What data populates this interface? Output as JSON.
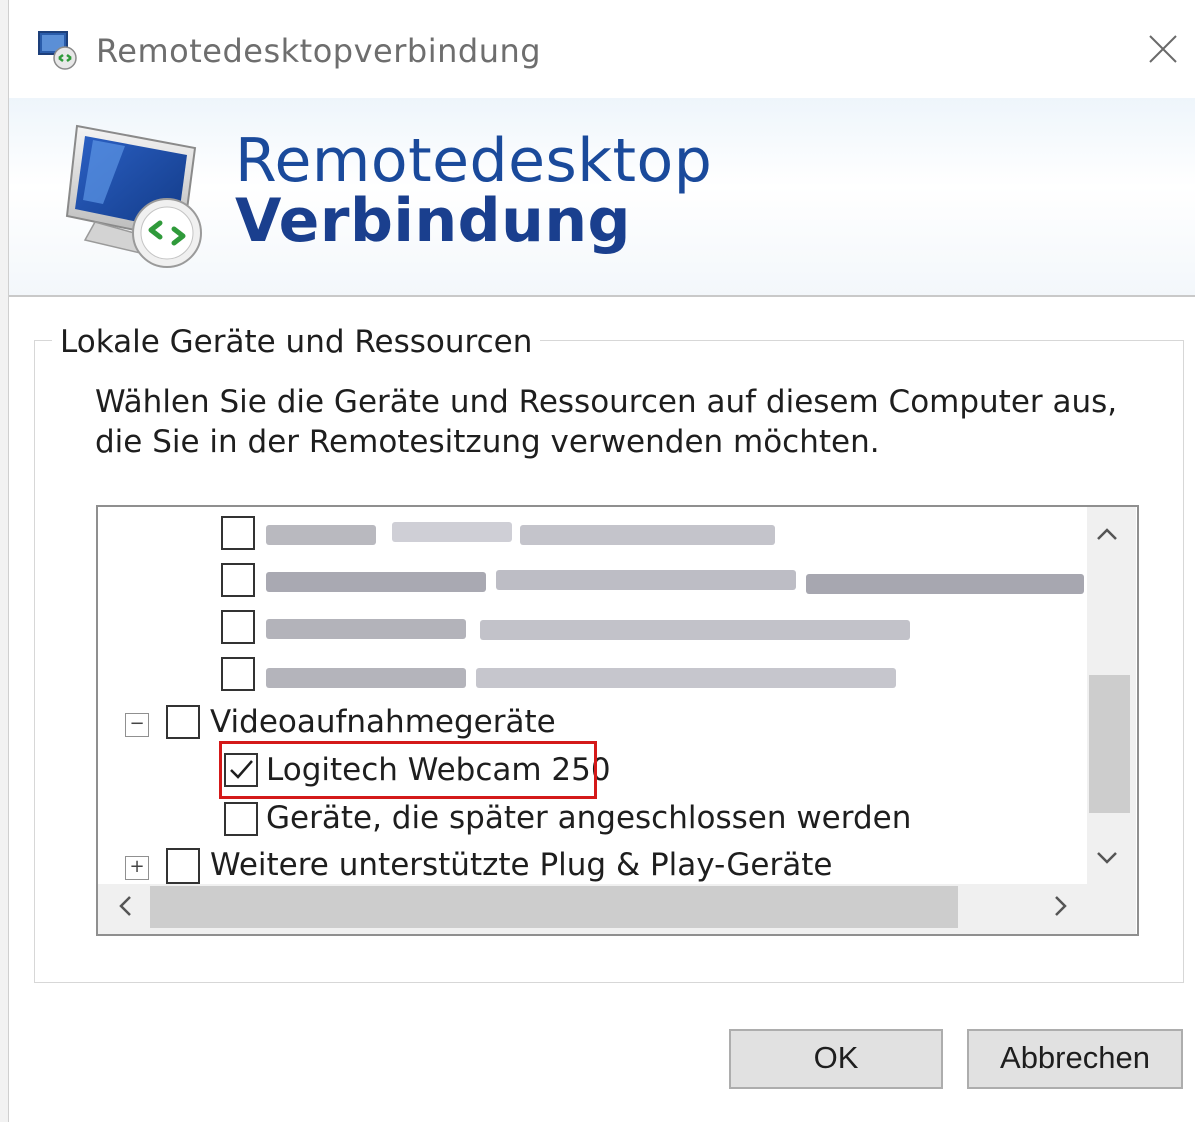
{
  "window": {
    "title": "Remotedesktopverbindung",
    "close_icon": "close-icon"
  },
  "banner": {
    "line1": "Remotedesktop",
    "line2": "Verbindung",
    "logo_icon": "remote-desktop-monitor-icon"
  },
  "group": {
    "legend": "Lokale Geräte und Ressourcen",
    "description": "Wählen Sie die Geräte und Ressourcen auf diesem Computer aus, die Sie in der Remotesitzung verwenden möchten."
  },
  "tree": {
    "redacted_items": [
      {
        "checked": false
      },
      {
        "checked": false
      },
      {
        "checked": false
      },
      {
        "checked": false
      }
    ],
    "video_group": {
      "label": "Videoaufnahmegeräte",
      "expanded": true,
      "checked": false
    },
    "webcam": {
      "label": "Logitech Webcam 250",
      "checked": true
    },
    "later_devices": {
      "label": "Geräte, die später angeschlossen werden",
      "checked": false
    },
    "pnp_group": {
      "label": "Weitere unterstützte Plug & Play-Geräte",
      "expanded": false,
      "checked": false
    }
  },
  "buttons": {
    "ok": "OK",
    "cancel": "Abbrechen"
  },
  "colors": {
    "banner_title": "#1a4a9b",
    "highlight": "#d41919"
  }
}
